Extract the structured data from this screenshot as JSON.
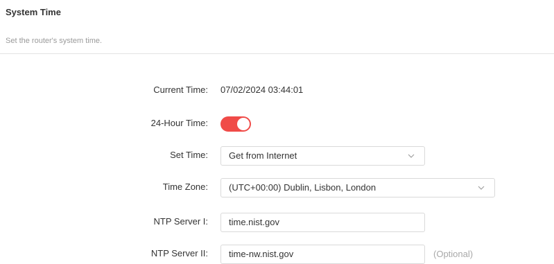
{
  "header": {
    "title": "System Time",
    "description": "Set the router's system time."
  },
  "form": {
    "current_time": {
      "label": "Current Time:",
      "value": "07/02/2024 03:44:01"
    },
    "hour24": {
      "label": "24-Hour Time:",
      "enabled": true
    },
    "set_time": {
      "label": "Set Time:",
      "value": "Get from Internet"
    },
    "time_zone": {
      "label": "Time Zone:",
      "value": "(UTC+00:00) Dublin, Lisbon, London"
    },
    "ntp1": {
      "label": "NTP Server I:",
      "value": "time.nist.gov"
    },
    "ntp2": {
      "label": "NTP Server II:",
      "value": "time-nw.nist.gov",
      "hint": "(Optional)"
    }
  },
  "colors": {
    "toggle_on": "#f04b48"
  },
  "icons": {
    "dropdown": "chevron-down-icon"
  }
}
